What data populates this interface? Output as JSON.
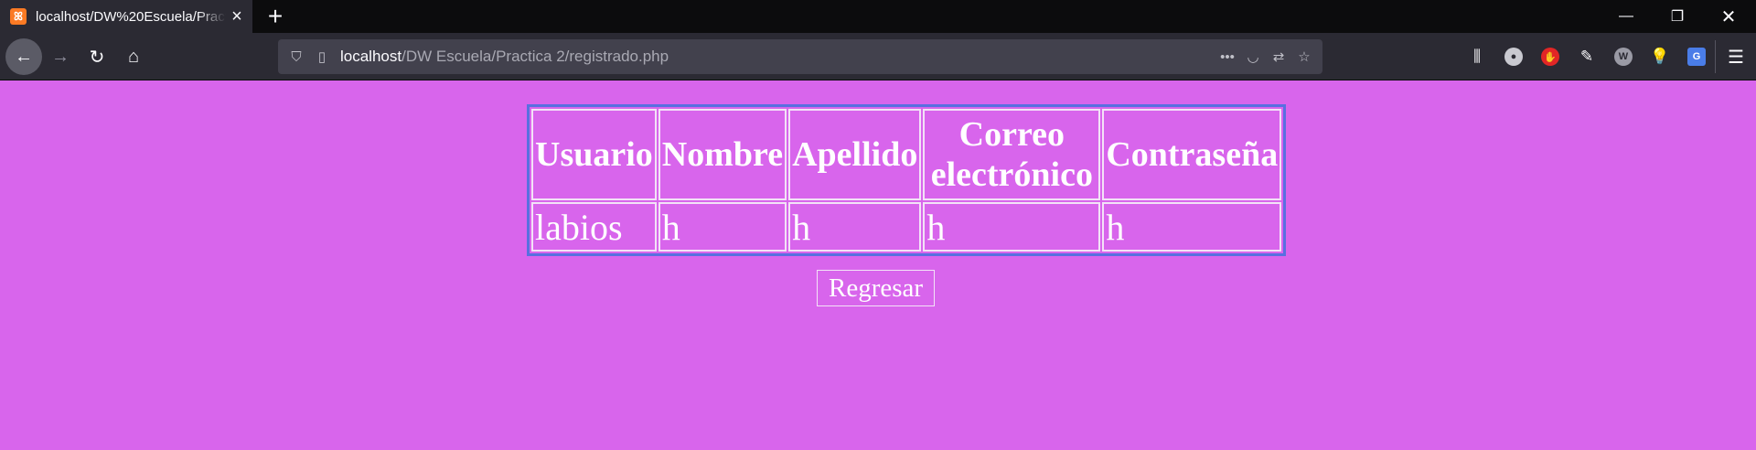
{
  "browser": {
    "tab_title": "localhost/DW%20Escuela/Practica 2/registrado.php",
    "url_host": "localhost",
    "url_path": "/DW Escuela/Practica 2/registrado.php"
  },
  "table": {
    "headers": [
      "Usuario",
      "Nombre",
      "Apellido",
      "Correo electrónico",
      "Contraseña"
    ],
    "rows": [
      [
        "labios",
        "h",
        "h",
        "h",
        "h"
      ]
    ]
  },
  "back_label": "Regresar",
  "colors": {
    "page_background": "#d865ec",
    "table_border": "#5870e0"
  }
}
